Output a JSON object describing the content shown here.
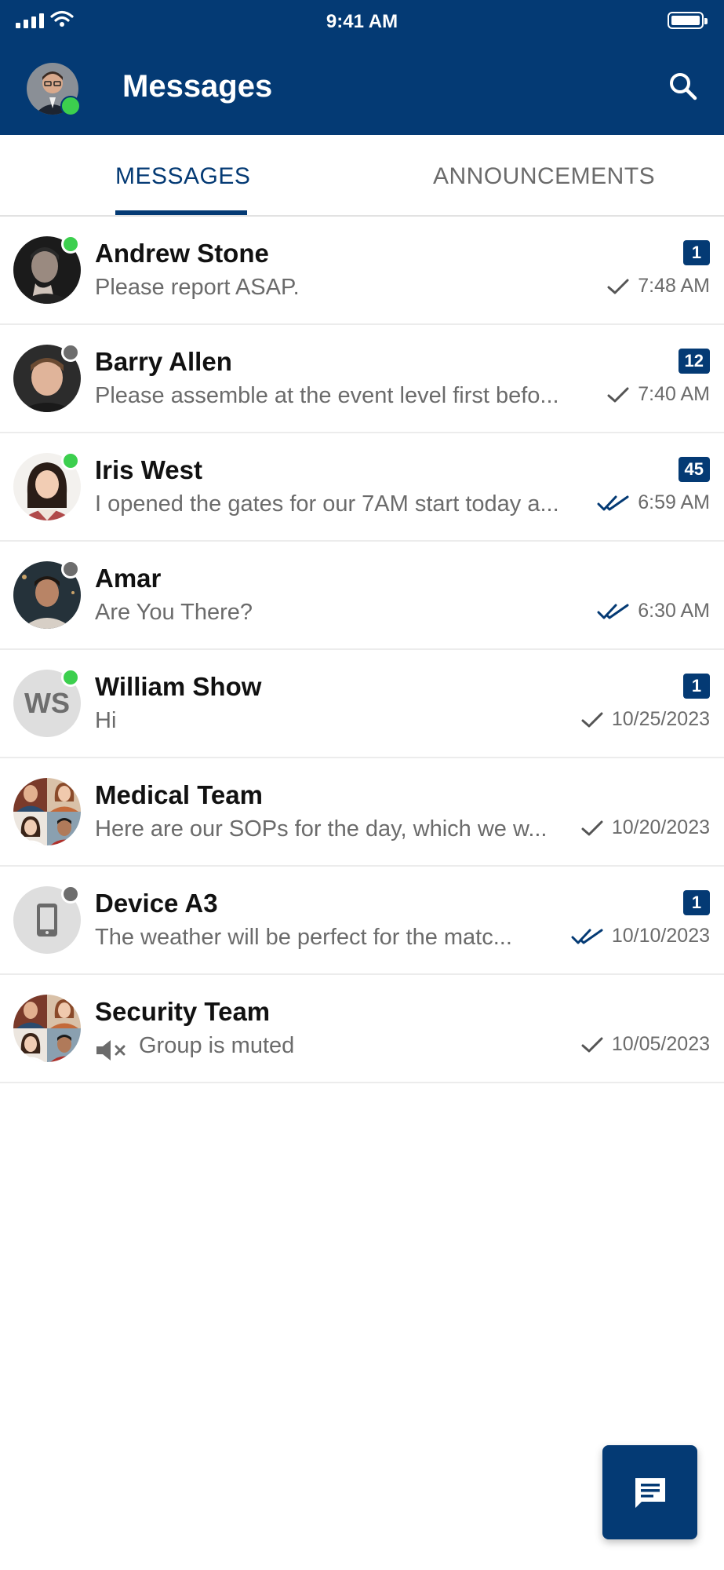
{
  "status_bar": {
    "time": "9:41 AM"
  },
  "header": {
    "title": "Messages"
  },
  "tabs": [
    {
      "label": "MESSAGES",
      "active": true
    },
    {
      "label": "ANNOUNCEMENTS",
      "active": false
    }
  ],
  "conversations": [
    {
      "name": "Andrew Stone",
      "preview": "Please report ASAP.",
      "time": "7:48 AM",
      "unread": "1",
      "presence": "online",
      "receipt": "sent"
    },
    {
      "name": "Barry Allen",
      "preview": "Please assemble at the event level first befo...",
      "time": "7:40 AM",
      "unread": "12",
      "presence": "offline",
      "receipt": "sent"
    },
    {
      "name": "Iris West",
      "preview": "I opened the gates for our 7AM start today a...",
      "time": "6:59 AM",
      "unread": "45",
      "presence": "online",
      "receipt": "read"
    },
    {
      "name": "Amar",
      "preview": "Are You There?",
      "time": "6:30 AM",
      "unread": "",
      "presence": "offline",
      "receipt": "read"
    },
    {
      "name": "William Show",
      "initials": "WS",
      "preview": "Hi",
      "time": "10/25/2023",
      "unread": "1",
      "presence": "online",
      "receipt": "sent"
    },
    {
      "name": "Medical Team",
      "preview": "Here are our SOPs for the day, which we w...",
      "time": "10/20/2023",
      "unread": "",
      "presence": "none",
      "receipt": "sent"
    },
    {
      "name": "Device A3",
      "preview": "The weather will be perfect for the matc...",
      "time": "10/10/2023",
      "unread": "1",
      "presence": "offline",
      "receipt": "read"
    },
    {
      "name": "Security Team",
      "preview": "Group is muted",
      "time": "10/05/2023",
      "unread": "",
      "presence": "none",
      "receipt": "sent"
    }
  ],
  "colors": {
    "brand": "#043a74",
    "online": "#3ccf4e",
    "offline": "#6d6d6d",
    "read_tick": "#043a74"
  },
  "icons": {
    "search": "search-icon",
    "compose": "chat-compose-icon",
    "muted": "speaker-muted-icon",
    "device": "phone-device-icon"
  }
}
